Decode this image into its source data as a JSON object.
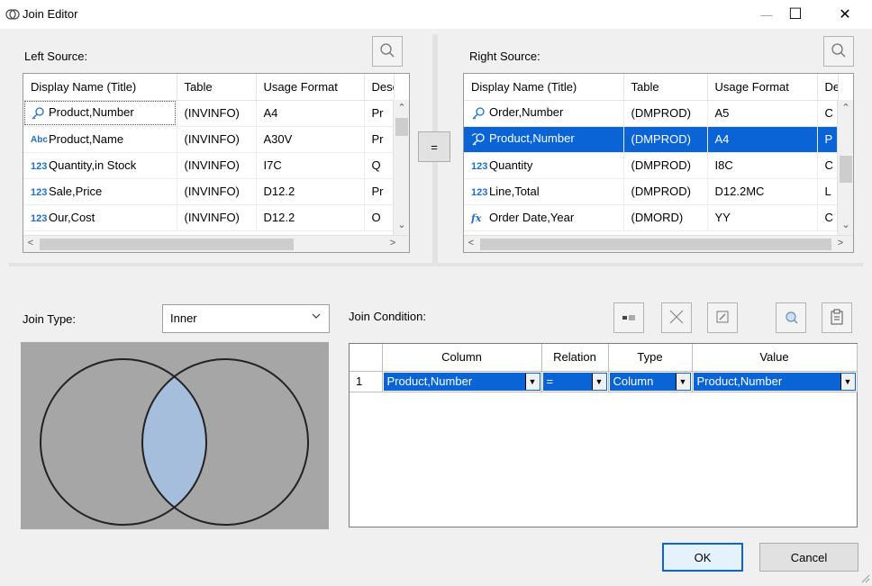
{
  "window": {
    "title": "Join Editor",
    "minimize_glyph": "—",
    "maximize_glyph": "☐",
    "close_glyph": "✕"
  },
  "left_source": {
    "label": "Left Source:",
    "columns": [
      "Display Name (Title)",
      "Table",
      "Usage Format",
      "Descr"
    ],
    "rows": [
      {
        "icon": "key-icon",
        "name": "Product,Number",
        "table": "(INVINFO)",
        "format": "A4",
        "desc": "Pr"
      },
      {
        "icon": "abc-icon",
        "icon_text": "Abc",
        "name": "Product,Name",
        "table": "(INVINFO)",
        "format": "A30V",
        "desc": "Pr"
      },
      {
        "icon": "numeric-icon",
        "icon_text": "123",
        "name": "Quantity,in Stock",
        "table": "(INVINFO)",
        "format": "I7C",
        "desc": "Q"
      },
      {
        "icon": "numeric-icon",
        "icon_text": "123",
        "name": "Sale,Price",
        "table": "(INVINFO)",
        "format": "D12.2",
        "desc": "Pr"
      },
      {
        "icon": "numeric-icon",
        "icon_text": "123",
        "name": "Our,Cost",
        "table": "(INVINFO)",
        "format": "D12.2",
        "desc": "O"
      }
    ]
  },
  "right_source": {
    "label": "Right Source:",
    "columns": [
      "Display Name (Title)",
      "Table",
      "Usage Format",
      "Desc"
    ],
    "rows": [
      {
        "icon": "key-icon",
        "name": "Order,Number",
        "table": "(DMPROD)",
        "format": "A5",
        "desc": "C"
      },
      {
        "icon": "linked-key-icon",
        "name": "Product,Number",
        "table": "(DMPROD)",
        "format": "A4",
        "desc": "P",
        "selected": true
      },
      {
        "icon": "numeric-icon",
        "icon_text": "123",
        "name": "Quantity",
        "table": "(DMPROD)",
        "format": "I8C",
        "desc": "C"
      },
      {
        "icon": "numeric-icon",
        "icon_text": "123",
        "name": "Line,Total",
        "table": "(DMPROD)",
        "format": "D12.2MC",
        "desc": "L"
      },
      {
        "icon": "function-icon",
        "icon_text": "fx",
        "name": "Order Date,Year",
        "table": "(DMORD)",
        "format": "YY",
        "desc": "C"
      }
    ]
  },
  "equals_button": "=",
  "join_type": {
    "label": "Join Type:",
    "value": "Inner"
  },
  "join_condition": {
    "label": "Join Condition:",
    "columns": [
      "Column",
      "Relation",
      "Type",
      "Value"
    ],
    "rows": [
      {
        "num": "1",
        "column": "Product,Number",
        "relation": "=",
        "type": "Column",
        "value": "Product,Number"
      }
    ]
  },
  "buttons": {
    "ok": "OK",
    "cancel": "Cancel"
  },
  "colors": {
    "selection": "#0a64d6",
    "venn_background": "#a6a6a6",
    "venn_overlap": "#a5bedc"
  }
}
